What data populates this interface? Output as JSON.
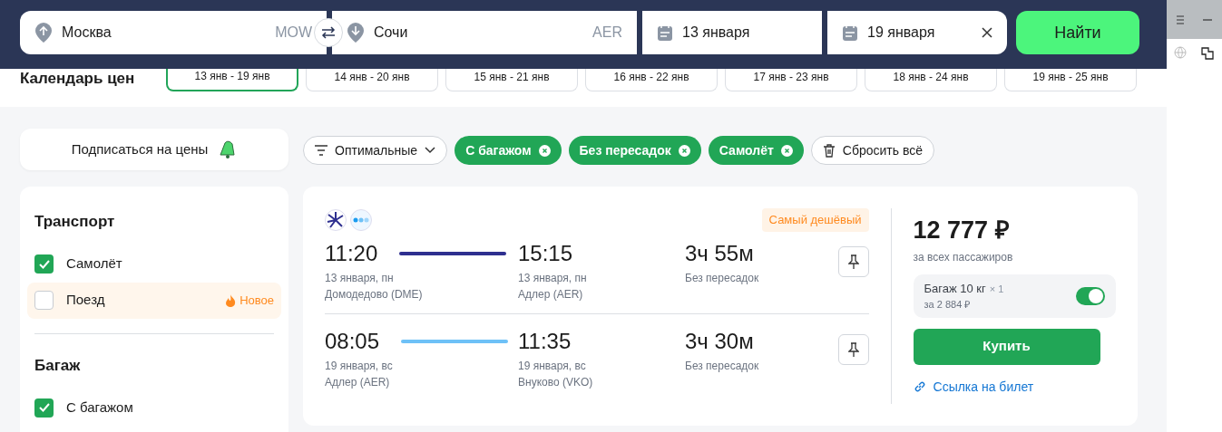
{
  "header": {
    "from": {
      "city": "Москва",
      "code": "MOW"
    },
    "to": {
      "city": "Сочи",
      "code": "AER"
    },
    "date_from": "13 января",
    "date_to": "19 января",
    "search_button": "Найти"
  },
  "price_calendar": {
    "title": "Календарь цен",
    "weeks": [
      {
        "label": "13 янв - 19 янв",
        "selected": true
      },
      {
        "label": "14 янв - 20 янв",
        "selected": false
      },
      {
        "label": "15 янв - 21 янв",
        "selected": false
      },
      {
        "label": "16 янв - 22 янв",
        "selected": false
      },
      {
        "label": "17 янв - 23 янв",
        "selected": false
      },
      {
        "label": "18 янв - 24 янв",
        "selected": false
      },
      {
        "label": "19 янв - 25 янв",
        "selected": false
      }
    ]
  },
  "subscribe": "Подписаться на цены",
  "sort": "Оптимальные",
  "filter_chips": [
    "С багажом",
    "Без пересадок",
    "Самолёт"
  ],
  "reset": "Сбросить всё",
  "sidebar": {
    "sections": [
      {
        "title": "Транспорт",
        "options": [
          {
            "label": "Самолёт",
            "checked": true,
            "highlighted": false
          },
          {
            "label": "Поезд",
            "checked": false,
            "highlighted": true,
            "badge": "Новое"
          }
        ]
      },
      {
        "title": "Багаж",
        "options": [
          {
            "label": "С багажом",
            "checked": true,
            "highlighted": false
          }
        ]
      }
    ]
  },
  "ticket": {
    "tag": "Самый дешёвый",
    "legs": [
      {
        "depart_time": "11:20",
        "depart_date": "13 января, пн",
        "depart_airport": "Домодедово (DME)",
        "arrive_time": "15:15",
        "arrive_date": "13 января, пн",
        "arrive_airport": "Адлер (AER)",
        "duration": "3ч 55м",
        "stops": "Без пересадок",
        "color": "#2e2f8f"
      },
      {
        "depart_time": "08:05",
        "depart_date": "19 января, вс",
        "depart_airport": "Адлер (AER)",
        "arrive_time": "11:35",
        "arrive_date": "19 января, вс",
        "arrive_airport": "Внуково (VKO)",
        "duration": "3ч 30м",
        "stops": "Без пересадок",
        "color": "#6ec1f7"
      }
    ],
    "price": "12 777 ₽",
    "price_note": "за всех пассажиров",
    "baggage": {
      "label": "Багаж 10 кг",
      "count": "× 1",
      "price": "за 2 884 ₽",
      "on": true
    },
    "buy": "Купить",
    "link": "Ссылка на билет"
  }
}
